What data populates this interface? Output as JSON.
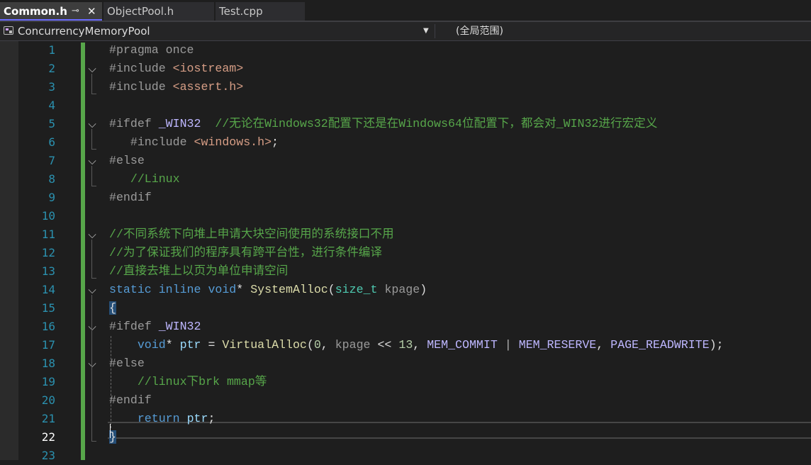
{
  "tabs": [
    {
      "label": "Common.h",
      "active": true,
      "pin_icon": "pin-icon",
      "close_icon": "close-icon"
    },
    {
      "label": "ObjectPool.h",
      "active": false
    },
    {
      "label": "Test.cpp",
      "active": false
    }
  ],
  "nav": {
    "scope": "ConcurrencyMemoryPool",
    "member": "(全局范围)"
  },
  "editor": {
    "current_line": 22,
    "line_numbers": [
      "1",
      "2",
      "3",
      "4",
      "5",
      "6",
      "7",
      "8",
      "9",
      "10",
      "11",
      "12",
      "13",
      "14",
      "15",
      "16",
      "17",
      "18",
      "19",
      "20",
      "21",
      "22",
      "23"
    ],
    "code_lines": [
      "#pragma once",
      "#include <iostream>",
      "#include <assert.h>",
      "",
      "#ifdef _WIN32  //无论在Windows32配置下还是在Windows64位配置下，都会对_WIN32进行宏定义",
      "   #include <windows.h>;",
      "#else",
      "   //Linux",
      "#endif",
      "",
      "//不同系统下向堆上申请大块空间使用的系统接口不用",
      "//为了保证我们的程序具有跨平台性，进行条件编译",
      "//直接去堆上以页为单位申请空间",
      "static inline void* SystemAlloc(size_t kpage)",
      "{",
      "#ifdef _WIN32",
      "    void* ptr = VirtualAlloc(0, kpage << 13, MEM_COMMIT | MEM_RESERVE, PAGE_READWRITE);",
      "#else",
      "    //linux下brk mmap等",
      "#endif",
      "    return ptr;",
      "}",
      ""
    ]
  },
  "colors": {
    "keyword": "#569cd6",
    "preprocessor": "#9b9b9b",
    "include_path": "#d69d85",
    "comment": "#57a64a",
    "function": "#dcdcaa",
    "type": "#4ec9b0",
    "macro": "#beb7ff",
    "line_number": "#2b91af",
    "change_bar": "#57a64a"
  }
}
